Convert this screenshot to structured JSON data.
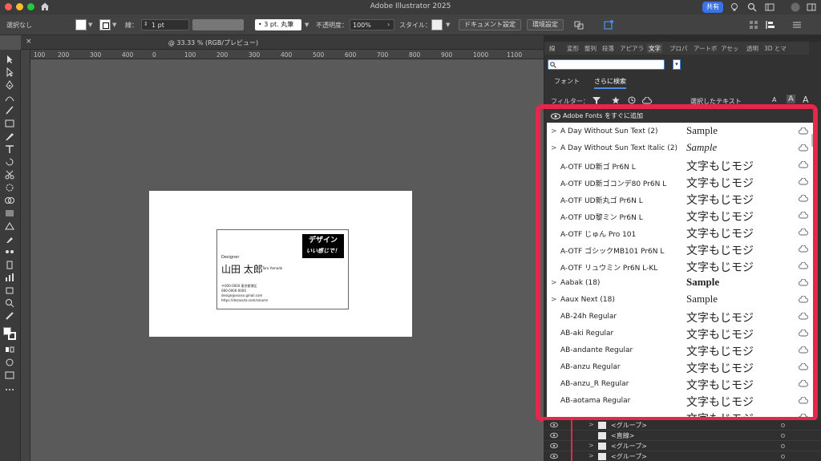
{
  "app": {
    "title": "Adobe Illustrator 2025",
    "share_label": "共有"
  },
  "controlbar": {
    "selection": "選択なし",
    "stroke_label": "線：",
    "stroke_value": "1 pt",
    "brush_value": "• 3 pt. 丸筆",
    "opacity_label": "不透明度：",
    "opacity_value": "100%",
    "style_label": "スタイル：",
    "doc_settings": "ドキュメント設定",
    "prefs": "環境設定"
  },
  "document": {
    "tab_label": "@ 33.33 % (RGB/プレビュー)",
    "close": "×"
  },
  "ruler": {
    "ticks": [
      "100",
      "200",
      "300",
      "400",
      "0",
      "100",
      "200",
      "300",
      "400",
      "500",
      "600",
      "700",
      "800",
      "900",
      "1000",
      "1100"
    ]
  },
  "card": {
    "logo_top": "デザイン",
    "logo_bottom": "いい感じで！",
    "role": "Designer",
    "name": "山田 太郎",
    "roman": "Taro Yamada",
    "info": [
      "〒000-0000 東京都港区",
      "080-0000-0000",
      "design@xxxxx.gmail.com",
      "https://dezasuta.com/column"
    ]
  },
  "panel": {
    "tabs": [
      "線",
      "変形",
      "整列",
      "段落",
      "アピアラ",
      "文字",
      "プロパ",
      "アートボ",
      "アセッ",
      "透明",
      "3D とマ"
    ],
    "active_tab": "文字",
    "search_value": "",
    "subtabs": [
      "フォント",
      "さらに検索"
    ],
    "filter_label": "フィルター：",
    "selected_text": "選択したテキスト",
    "size_small": "A",
    "size_large": "A"
  },
  "fontlist": {
    "header": "Adobe Fonts をすぐに追加",
    "rows": [
      {
        "arrow": ">",
        "name": "A Day Without Sun Text (2)",
        "sample": "Sample",
        "en": true
      },
      {
        "arrow": ">",
        "name": "A Day Without Sun Text Italic (2)",
        "sample": "Sample",
        "en": true
      },
      {
        "arrow": "",
        "name": "A-OTF UD新ゴ Pr6N L",
        "sample": "文字もじモジ",
        "en": false
      },
      {
        "arrow": "",
        "name": "A-OTF UD新ゴコンデ80 Pr6N L",
        "sample": "文字もじモジ",
        "en": false
      },
      {
        "arrow": "",
        "name": "A-OTF UD新丸ゴ Pr6N L",
        "sample": "文字もじモジ",
        "en": false
      },
      {
        "arrow": "",
        "name": "A-OTF UD黎ミン Pr6N L",
        "sample": "文字もじモジ",
        "en": false
      },
      {
        "arrow": "",
        "name": "A-OTF じゅん Pro 101",
        "sample": "文字もじモジ",
        "en": false
      },
      {
        "arrow": "",
        "name": "A-OTF ゴシックMB101 Pr6N L",
        "sample": "文字もじモジ",
        "en": false
      },
      {
        "arrow": "",
        "name": "A-OTF リュウミン Pr6N L-KL",
        "sample": "文字もじモジ",
        "en": false
      },
      {
        "arrow": ">",
        "name": "Aabak (18)",
        "sample": "Sample",
        "en": true
      },
      {
        "arrow": ">",
        "name": "Aaux Next (18)",
        "sample": "Sample",
        "en": true
      },
      {
        "arrow": "",
        "name": "AB-24h Regular",
        "sample": "文字もじモジ",
        "en": false
      },
      {
        "arrow": "",
        "name": "AB-aki Regular",
        "sample": "文字もじモジ",
        "en": false
      },
      {
        "arrow": "",
        "name": "AB-andante Regular",
        "sample": "文字もじモジ",
        "en": false
      },
      {
        "arrow": "",
        "name": "AB-anzu Regular",
        "sample": "文字もじモジ",
        "en": false
      },
      {
        "arrow": "",
        "name": "AB-anzu_R Regular",
        "sample": "文字もじモジ",
        "en": false
      },
      {
        "arrow": "",
        "name": "AB-aotama Regular",
        "sample": "文字もじモジ",
        "en": false
      },
      {
        "arrow": "",
        "name": "",
        "sample": "文字もじモジ",
        "en": false
      }
    ]
  },
  "layers": {
    "rows": [
      {
        "arrow": ">",
        "name": "<グループ>"
      },
      {
        "arrow": "",
        "name": "<直線>"
      },
      {
        "arrow": ">",
        "name": "<グループ>"
      },
      {
        "arrow": ">",
        "name": "<グループ>"
      }
    ]
  },
  "icons": {
    "home": "home-icon",
    "search": "search-icon",
    "cloud": "cloud-download-icon",
    "eye": "eye-icon"
  },
  "colors": {
    "highlight": "#e8254a",
    "share": "#3b72e8",
    "accent": "#4d8ce6"
  }
}
